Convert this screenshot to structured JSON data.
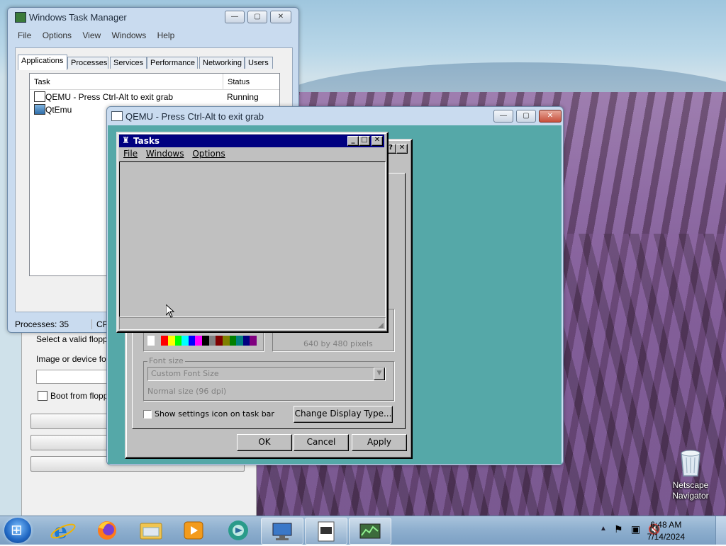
{
  "taskmgr": {
    "title": "Windows Task Manager",
    "menu": [
      "File",
      "Options",
      "View",
      "Windows",
      "Help"
    ],
    "tabs": [
      "Applications",
      "Processes",
      "Services",
      "Performance",
      "Networking",
      "Users"
    ],
    "columns": {
      "task": "Task",
      "status": "Status"
    },
    "rows": [
      {
        "task": "QEMU - Press Ctrl-Alt to exit grab",
        "status": "Running"
      },
      {
        "task": "QtEmu",
        "status": ""
      }
    ],
    "status_processes": "Processes: 35",
    "status_cpu": "CPU"
  },
  "qtemu_dialog": {
    "floppy_label": "Select a valid floppy",
    "image_label": "Image or device for f",
    "boot_floppy": "Boot from floppy"
  },
  "qemu": {
    "title": "QEMU - Press Ctrl-Alt to exit grab"
  },
  "display_props": {
    "resolution_text": "640 by 480 pixels",
    "font_size_label": "Font size",
    "font_size_value": "Custom Font Size",
    "font_size_note": "Normal size (96 dpi)",
    "show_settings_icon": "Show settings icon on task bar",
    "change_display_type": "Change Display Type...",
    "ok": "OK",
    "cancel": "Cancel",
    "apply": "Apply",
    "palette_colors": [
      "#ffffff",
      "#c0c0c0",
      "#ff0000",
      "#ffff00",
      "#00ff00",
      "#00ffff",
      "#0000ff",
      "#ff00ff",
      "#000000",
      "#808080",
      "#800000",
      "#808000",
      "#008000",
      "#008080",
      "#000080",
      "#800080"
    ]
  },
  "tasks_window": {
    "title": "Tasks",
    "menu": [
      "File",
      "Windows",
      "Options"
    ]
  },
  "desktop": {
    "recycle_label": "Netscape Navigator"
  },
  "taskbar": {
    "time": "6:48 AM",
    "date": "7/14/2024"
  },
  "colors": {
    "win95_title": "#000080",
    "qemu_screen": "#55a8a8",
    "win95_face": "#c0c0c0"
  }
}
